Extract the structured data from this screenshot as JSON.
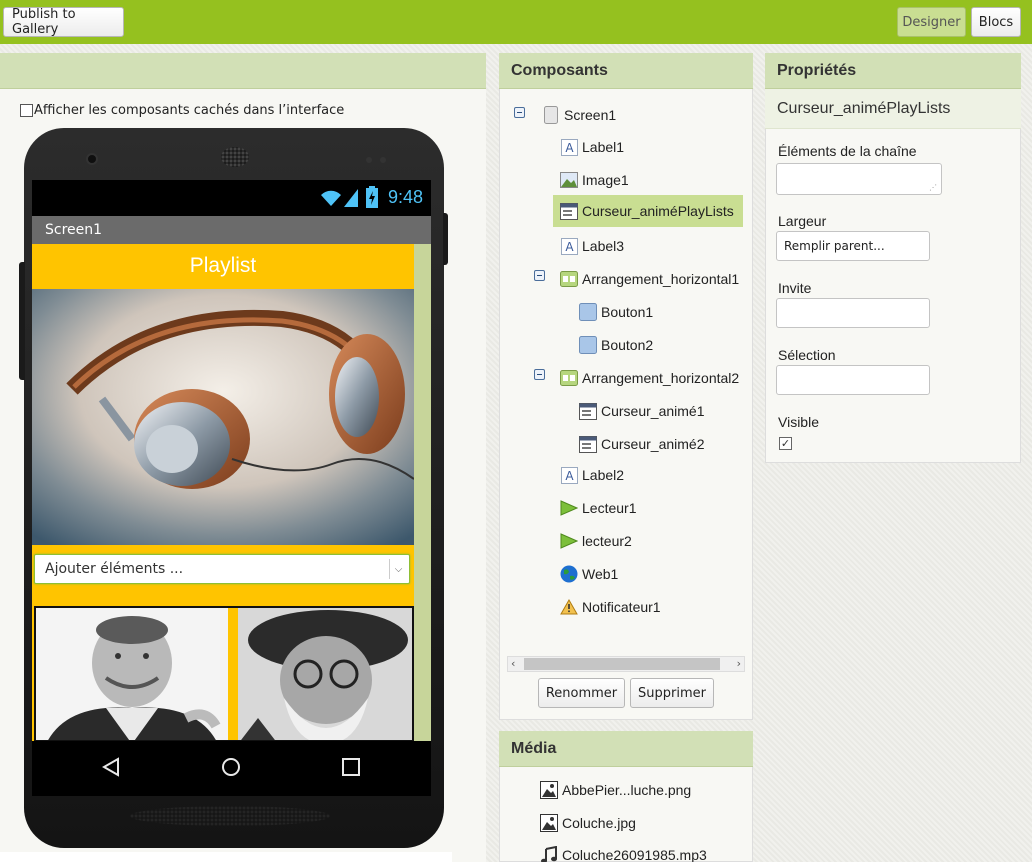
{
  "topbar": {
    "publish_label": "Publish to Gallery",
    "designer_label": "Designer",
    "blocks_label": "Blocs"
  },
  "viewer": {
    "hidden_components_label": "Afficher les composants cachés dans l’interface"
  },
  "phone": {
    "clock": "9:48",
    "screen_title": "Screen1",
    "playlist_label": "Playlist",
    "picker_text": "Ajouter éléments ..."
  },
  "components": {
    "title": "Composants",
    "tree": [
      {
        "label": "Screen1",
        "icon": "screen-icon"
      },
      {
        "label": "Label1",
        "icon": "label-icon"
      },
      {
        "label": "Image1",
        "icon": "image-icon"
      },
      {
        "label": "Curseur_animéPlayLists",
        "icon": "listpicker-icon"
      },
      {
        "label": "Label3",
        "icon": "label-icon"
      },
      {
        "label": "Arrangement_horizontal1",
        "icon": "horizontal-arrangement-icon"
      },
      {
        "label": "Bouton1",
        "icon": "button-icon"
      },
      {
        "label": "Bouton2",
        "icon": "button-icon"
      },
      {
        "label": "Arrangement_horizontal2",
        "icon": "horizontal-arrangement-icon"
      },
      {
        "label": "Curseur_animé1",
        "icon": "listpicker-icon"
      },
      {
        "label": "Curseur_animé2",
        "icon": "listpicker-icon"
      },
      {
        "label": "Label2",
        "icon": "label-icon"
      },
      {
        "label": "Lecteur1",
        "icon": "player-icon"
      },
      {
        "label": "lecteur2",
        "icon": "player-icon"
      },
      {
        "label": "Web1",
        "icon": "web-icon"
      },
      {
        "label": "Notificateur1",
        "icon": "notifier-icon"
      }
    ],
    "rename_label": "Renommer",
    "delete_label": "Supprimer"
  },
  "media": {
    "title": "Média",
    "items": [
      "AbbePier...luche.png",
      "Coluche.jpg",
      "Coluche26091985.mp3"
    ]
  },
  "properties": {
    "title": "Propriétés",
    "component_name": "Curseur_animéPlayLists",
    "elements_label": "Éléments de la chaîne",
    "elements_value": "",
    "width_label": "Largeur",
    "width_value": "Remplir parent...",
    "prompt_label": "Invite",
    "prompt_value": "",
    "selection_label": "Sélection",
    "selection_value": "",
    "visible_label": "Visible",
    "visible_checked": true
  },
  "colors": {
    "topbar": "#95c11f",
    "panel_header": "#d2e0b6",
    "selection": "#c9de92",
    "app_background": "#ffc400",
    "clock": "#4fc3f7"
  }
}
